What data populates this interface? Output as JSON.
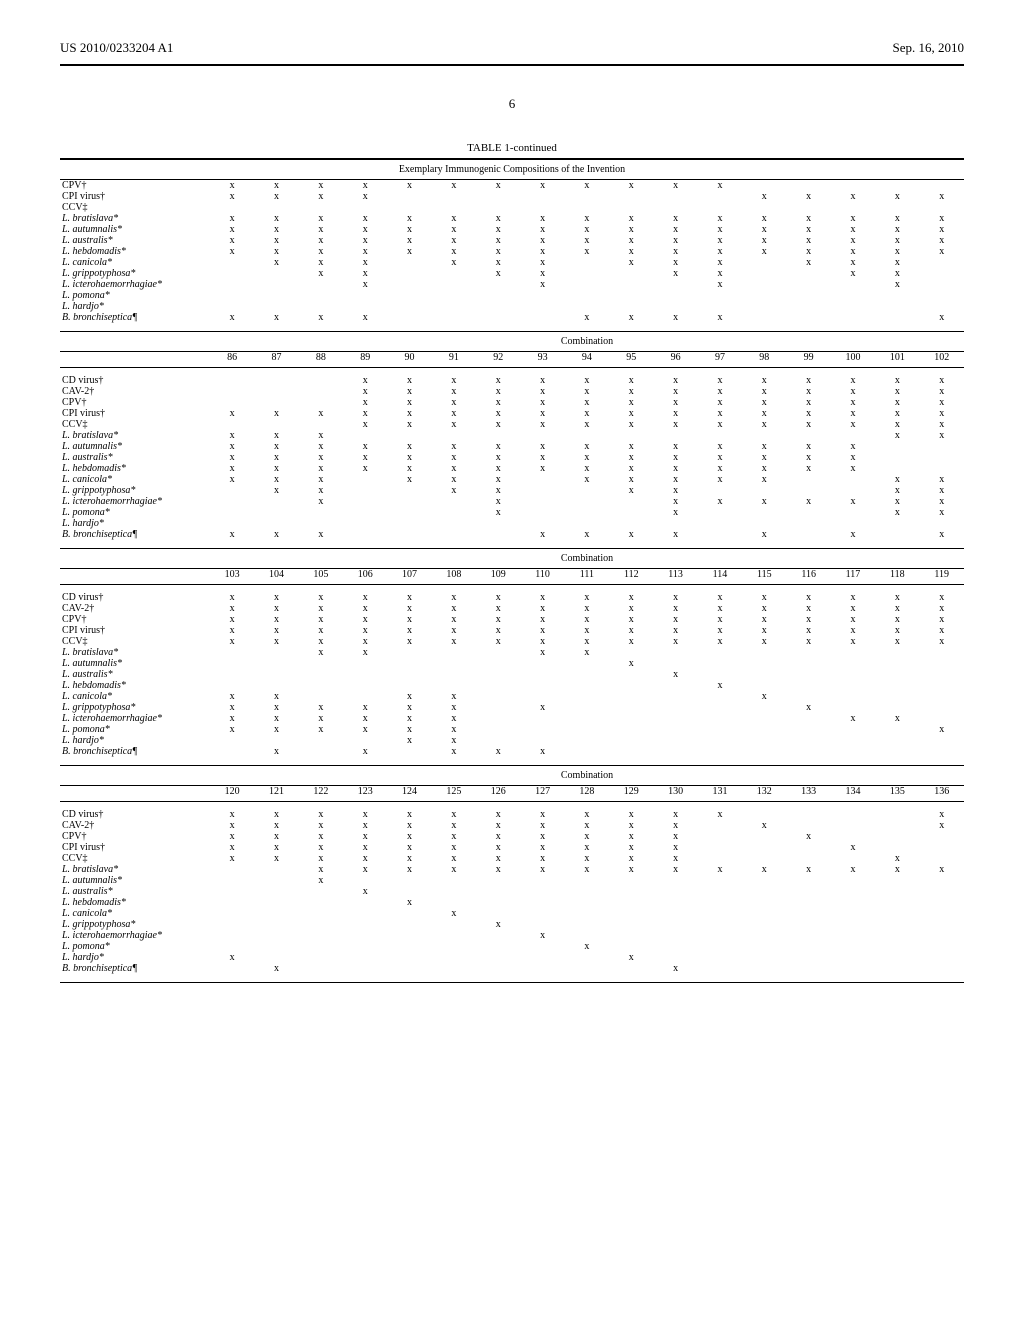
{
  "header": {
    "left": "US 2010/0233204 A1",
    "right": "Sep. 16, 2010"
  },
  "pagenum": "6",
  "tablecaption": "TABLE 1-continued",
  "tablesubtitle": "Exemplary Immunogenic Compositions of the Invention",
  "comb_label": "Combination",
  "rows_labels": [
    {
      "t": "CPV†",
      "i": 0
    },
    {
      "t": "CPI virus†",
      "i": 0
    },
    {
      "t": "CCV‡",
      "i": 0
    },
    {
      "t": "L. bratislava*",
      "i": 1
    },
    {
      "t": "L. autumnalis*",
      "i": 1
    },
    {
      "t": "L. australis*",
      "i": 1
    },
    {
      "t": "L. hebdomadis*",
      "i": 1
    },
    {
      "t": "L. canicola*",
      "i": 1
    },
    {
      "t": "L. grippotyphosa*",
      "i": 1
    },
    {
      "t": "L. icterohaemorrhagiae*",
      "i": 1
    },
    {
      "t": "L. pomona*",
      "i": 1
    },
    {
      "t": "L. hardjo*",
      "i": 1
    },
    {
      "t": "B. bronchiseptica¶",
      "i": 1
    }
  ],
  "rows_labels2": [
    {
      "t": "CD virus†",
      "i": 0
    },
    {
      "t": "CAV-2†",
      "i": 0
    },
    {
      "t": "CPV†",
      "i": 0
    },
    {
      "t": "CPI virus†",
      "i": 0
    },
    {
      "t": "CCV‡",
      "i": 0
    },
    {
      "t": "L. bratislava*",
      "i": 1
    },
    {
      "t": "L. autumnalis*",
      "i": 1
    },
    {
      "t": "L. australis*",
      "i": 1
    },
    {
      "t": "L. hebdomadis*",
      "i": 1
    },
    {
      "t": "L. canicola*",
      "i": 1
    },
    {
      "t": "L. grippotyphosa*",
      "i": 1
    },
    {
      "t": "L. icterohaemorrhagiae*",
      "i": 1
    },
    {
      "t": "L. pomona*",
      "i": 1
    },
    {
      "t": "L. hardjo*",
      "i": 1
    },
    {
      "t": "B. bronchiseptica¶",
      "i": 1
    }
  ],
  "chart_data": [
    {
      "type": "table",
      "title": "Section 1 (continued columns)",
      "cols": 17,
      "matrix": [
        [
          1,
          1,
          1,
          1,
          1,
          1,
          1,
          1,
          1,
          1,
          1,
          1,
          0,
          0,
          0,
          0,
          0
        ],
        [
          1,
          1,
          1,
          1,
          0,
          0,
          0,
          0,
          0,
          0,
          0,
          0,
          1,
          1,
          1,
          1,
          1
        ],
        [
          0,
          0,
          0,
          0,
          0,
          0,
          0,
          0,
          0,
          0,
          0,
          0,
          0,
          0,
          0,
          0,
          0
        ],
        [
          1,
          1,
          1,
          1,
          1,
          1,
          1,
          1,
          1,
          1,
          1,
          1,
          1,
          1,
          1,
          1,
          1
        ],
        [
          1,
          1,
          1,
          1,
          1,
          1,
          1,
          1,
          1,
          1,
          1,
          1,
          1,
          1,
          1,
          1,
          1
        ],
        [
          1,
          1,
          1,
          1,
          1,
          1,
          1,
          1,
          1,
          1,
          1,
          1,
          1,
          1,
          1,
          1,
          1
        ],
        [
          1,
          1,
          1,
          1,
          1,
          1,
          1,
          1,
          1,
          1,
          1,
          1,
          1,
          1,
          1,
          1,
          1
        ],
        [
          0,
          1,
          1,
          1,
          0,
          1,
          1,
          1,
          0,
          1,
          1,
          1,
          0,
          1,
          1,
          1,
          0
        ],
        [
          0,
          0,
          1,
          1,
          0,
          0,
          1,
          1,
          0,
          0,
          1,
          1,
          0,
          0,
          1,
          1,
          0
        ],
        [
          0,
          0,
          0,
          1,
          0,
          0,
          0,
          1,
          0,
          0,
          0,
          1,
          0,
          0,
          0,
          1,
          0
        ],
        [
          0,
          0,
          0,
          0,
          0,
          0,
          0,
          0,
          0,
          0,
          0,
          0,
          0,
          0,
          0,
          0,
          0
        ],
        [
          0,
          0,
          0,
          0,
          0,
          0,
          0,
          0,
          0,
          0,
          0,
          0,
          0,
          0,
          0,
          0,
          0
        ],
        [
          1,
          1,
          1,
          1,
          0,
          0,
          0,
          0,
          1,
          1,
          1,
          1,
          0,
          0,
          0,
          0,
          1
        ]
      ]
    },
    {
      "type": "table",
      "title": "Combination 86-102",
      "cols": [
        "86",
        "87",
        "88",
        "89",
        "90",
        "91",
        "92",
        "93",
        "94",
        "95",
        "96",
        "97",
        "98",
        "99",
        "100",
        "101",
        "102"
      ],
      "matrix": [
        [
          0,
          0,
          0,
          1,
          1,
          1,
          1,
          1,
          1,
          1,
          1,
          1,
          1,
          1,
          1,
          1,
          1
        ],
        [
          0,
          0,
          0,
          1,
          1,
          1,
          1,
          1,
          1,
          1,
          1,
          1,
          1,
          1,
          1,
          1,
          1
        ],
        [
          0,
          0,
          0,
          1,
          1,
          1,
          1,
          1,
          1,
          1,
          1,
          1,
          1,
          1,
          1,
          1,
          1
        ],
        [
          1,
          1,
          1,
          1,
          1,
          1,
          1,
          1,
          1,
          1,
          1,
          1,
          1,
          1,
          1,
          1,
          1
        ],
        [
          0,
          0,
          0,
          1,
          1,
          1,
          1,
          1,
          1,
          1,
          1,
          1,
          1,
          1,
          1,
          1,
          1
        ],
        [
          1,
          1,
          1,
          0,
          0,
          0,
          0,
          0,
          0,
          0,
          0,
          0,
          0,
          0,
          0,
          1,
          1
        ],
        [
          1,
          1,
          1,
          1,
          1,
          1,
          1,
          1,
          1,
          1,
          1,
          1,
          1,
          1,
          1,
          0,
          0
        ],
        [
          1,
          1,
          1,
          1,
          1,
          1,
          1,
          1,
          1,
          1,
          1,
          1,
          1,
          1,
          1,
          0,
          0
        ],
        [
          1,
          1,
          1,
          1,
          1,
          1,
          1,
          1,
          1,
          1,
          1,
          1,
          1,
          1,
          1,
          0,
          0
        ],
        [
          1,
          1,
          1,
          0,
          1,
          1,
          1,
          0,
          1,
          1,
          1,
          1,
          1,
          0,
          0,
          1,
          1
        ],
        [
          0,
          1,
          1,
          0,
          0,
          1,
          1,
          0,
          0,
          1,
          1,
          0,
          0,
          0,
          0,
          1,
          1
        ],
        [
          0,
          0,
          1,
          0,
          0,
          0,
          1,
          0,
          0,
          0,
          1,
          1,
          1,
          1,
          1,
          1,
          1
        ],
        [
          0,
          0,
          0,
          0,
          0,
          0,
          1,
          0,
          0,
          0,
          1,
          0,
          0,
          0,
          0,
          1,
          1
        ],
        [
          0,
          0,
          0,
          0,
          0,
          0,
          0,
          0,
          0,
          0,
          0,
          0,
          0,
          0,
          0,
          0,
          0
        ],
        [
          1,
          1,
          1,
          0,
          0,
          0,
          0,
          1,
          1,
          1,
          1,
          0,
          1,
          0,
          1,
          0,
          1
        ]
      ]
    },
    {
      "type": "table",
      "title": "Combination 103-119",
      "cols": [
        "103",
        "104",
        "105",
        "106",
        "107",
        "108",
        "109",
        "110",
        "111",
        "112",
        "113",
        "114",
        "115",
        "116",
        "117",
        "118",
        "119"
      ],
      "matrix": [
        [
          1,
          1,
          1,
          1,
          1,
          1,
          1,
          1,
          1,
          1,
          1,
          1,
          1,
          1,
          1,
          1,
          1
        ],
        [
          1,
          1,
          1,
          1,
          1,
          1,
          1,
          1,
          1,
          1,
          1,
          1,
          1,
          1,
          1,
          1,
          1
        ],
        [
          1,
          1,
          1,
          1,
          1,
          1,
          1,
          1,
          1,
          1,
          1,
          1,
          1,
          1,
          1,
          1,
          1
        ],
        [
          1,
          1,
          1,
          1,
          1,
          1,
          1,
          1,
          1,
          1,
          1,
          1,
          1,
          1,
          1,
          1,
          1
        ],
        [
          1,
          1,
          1,
          1,
          1,
          1,
          1,
          1,
          1,
          1,
          1,
          1,
          1,
          1,
          1,
          1,
          1
        ],
        [
          0,
          0,
          1,
          1,
          0,
          0,
          0,
          1,
          1,
          0,
          0,
          0,
          0,
          0,
          0,
          0,
          0
        ],
        [
          0,
          0,
          0,
          0,
          0,
          0,
          0,
          0,
          0,
          1,
          0,
          0,
          0,
          0,
          0,
          0,
          0
        ],
        [
          0,
          0,
          0,
          0,
          0,
          0,
          0,
          0,
          0,
          0,
          1,
          0,
          0,
          0,
          0,
          0,
          0
        ],
        [
          0,
          0,
          0,
          0,
          0,
          0,
          0,
          0,
          0,
          0,
          0,
          1,
          0,
          0,
          0,
          0,
          0
        ],
        [
          1,
          1,
          0,
          0,
          1,
          1,
          0,
          0,
          0,
          0,
          0,
          0,
          1,
          0,
          0,
          0,
          0
        ],
        [
          1,
          1,
          1,
          1,
          1,
          1,
          0,
          1,
          0,
          0,
          0,
          0,
          0,
          1,
          0,
          0,
          0
        ],
        [
          1,
          1,
          1,
          1,
          1,
          1,
          0,
          0,
          0,
          0,
          0,
          0,
          0,
          0,
          1,
          1,
          0
        ],
        [
          1,
          1,
          1,
          1,
          1,
          1,
          0,
          0,
          0,
          0,
          0,
          0,
          0,
          0,
          0,
          0,
          1
        ],
        [
          0,
          0,
          0,
          0,
          1,
          1,
          0,
          0,
          0,
          0,
          0,
          0,
          0,
          0,
          0,
          0,
          0
        ],
        [
          0,
          1,
          0,
          1,
          0,
          1,
          1,
          1,
          0,
          0,
          0,
          0,
          0,
          0,
          0,
          0,
          0
        ]
      ]
    },
    {
      "type": "table",
      "title": "Combination 120-136",
      "cols": [
        "120",
        "121",
        "122",
        "123",
        "124",
        "125",
        "126",
        "127",
        "128",
        "129",
        "130",
        "131",
        "132",
        "133",
        "134",
        "135",
        "136"
      ],
      "matrix": [
        [
          1,
          1,
          1,
          1,
          1,
          1,
          1,
          1,
          1,
          1,
          1,
          1,
          0,
          0,
          0,
          0,
          1
        ],
        [
          1,
          1,
          1,
          1,
          1,
          1,
          1,
          1,
          1,
          1,
          1,
          0,
          1,
          0,
          0,
          0,
          1
        ],
        [
          1,
          1,
          1,
          1,
          1,
          1,
          1,
          1,
          1,
          1,
          1,
          0,
          0,
          1,
          0,
          0,
          0
        ],
        [
          1,
          1,
          1,
          1,
          1,
          1,
          1,
          1,
          1,
          1,
          1,
          0,
          0,
          0,
          1,
          0,
          0
        ],
        [
          1,
          1,
          1,
          1,
          1,
          1,
          1,
          1,
          1,
          1,
          1,
          0,
          0,
          0,
          0,
          1,
          0
        ],
        [
          0,
          0,
          1,
          1,
          1,
          1,
          1,
          1,
          1,
          1,
          1,
          1,
          1,
          1,
          1,
          1,
          1
        ],
        [
          0,
          0,
          1,
          0,
          0,
          0,
          0,
          0,
          0,
          0,
          0,
          0,
          0,
          0,
          0,
          0,
          0
        ],
        [
          0,
          0,
          0,
          1,
          0,
          0,
          0,
          0,
          0,
          0,
          0,
          0,
          0,
          0,
          0,
          0,
          0
        ],
        [
          0,
          0,
          0,
          0,
          1,
          0,
          0,
          0,
          0,
          0,
          0,
          0,
          0,
          0,
          0,
          0,
          0
        ],
        [
          0,
          0,
          0,
          0,
          0,
          1,
          0,
          0,
          0,
          0,
          0,
          0,
          0,
          0,
          0,
          0,
          0
        ],
        [
          0,
          0,
          0,
          0,
          0,
          0,
          1,
          0,
          0,
          0,
          0,
          0,
          0,
          0,
          0,
          0,
          0
        ],
        [
          0,
          0,
          0,
          0,
          0,
          0,
          0,
          1,
          0,
          0,
          0,
          0,
          0,
          0,
          0,
          0,
          0
        ],
        [
          0,
          0,
          0,
          0,
          0,
          0,
          0,
          0,
          1,
          0,
          0,
          0,
          0,
          0,
          0,
          0,
          0
        ],
        [
          1,
          0,
          0,
          0,
          0,
          0,
          0,
          0,
          0,
          1,
          0,
          0,
          0,
          0,
          0,
          0,
          0
        ],
        [
          0,
          1,
          0,
          0,
          0,
          0,
          0,
          0,
          0,
          0,
          1,
          0,
          0,
          0,
          0,
          0,
          0
        ]
      ]
    }
  ]
}
